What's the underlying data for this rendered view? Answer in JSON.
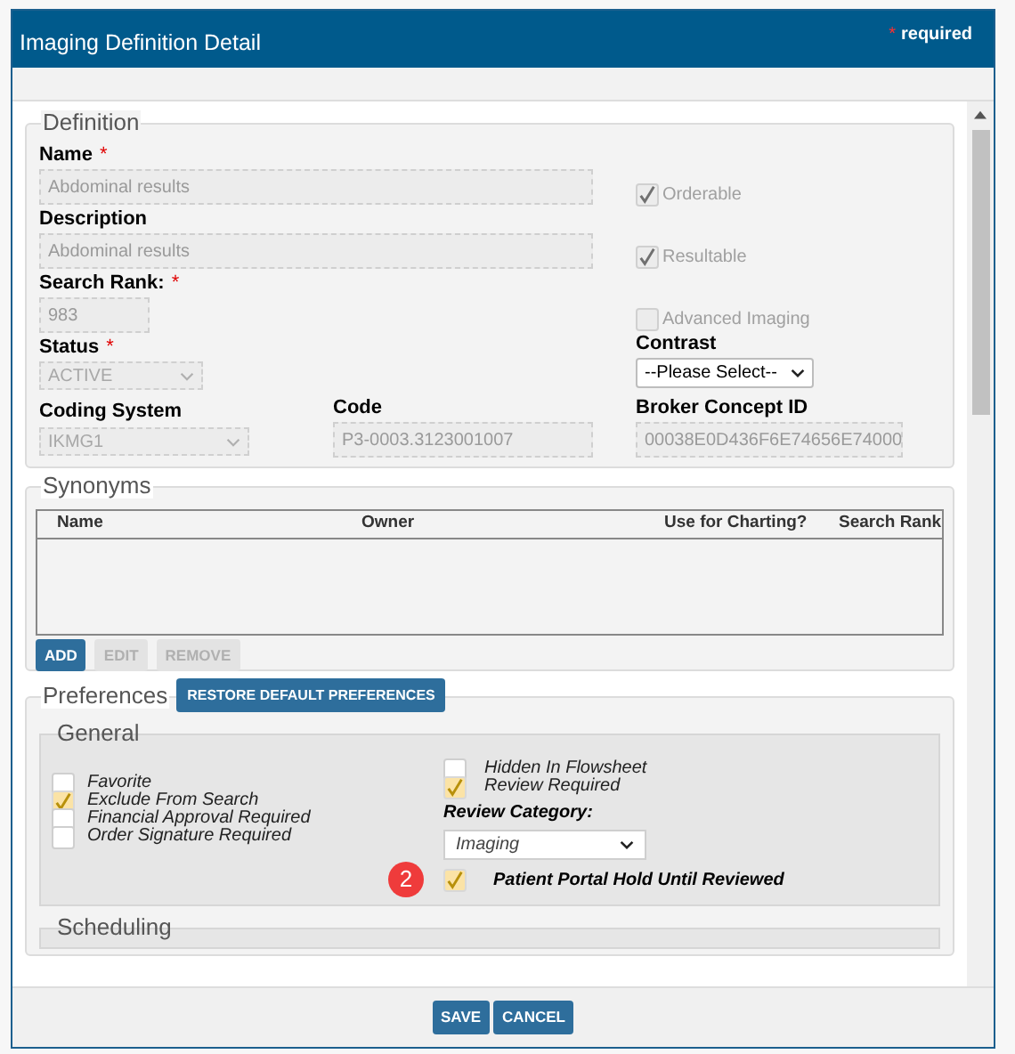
{
  "dialog": {
    "title": "Imaging Definition Detail",
    "required_mark": "*",
    "required_label": "required"
  },
  "definition": {
    "legend": "Definition",
    "name": {
      "label": "Name",
      "marker": "*",
      "value": "Abdominal results"
    },
    "description": {
      "label": "Description",
      "value": "Abdominal results"
    },
    "search_rank": {
      "label": "Search Rank:",
      "marker": "*",
      "value": "983"
    },
    "status": {
      "label": "Status",
      "marker": "*",
      "value": "ACTIVE"
    },
    "flags": [
      {
        "label": "Orderable",
        "checked": true
      },
      {
        "label": "Resultable",
        "checked": true
      },
      {
        "label": "Advanced Imaging",
        "checked": false
      }
    ],
    "contrast": {
      "label": "Contrast",
      "value": "--Please Select--"
    },
    "coding_system": {
      "label": "Coding System",
      "value": "IKMG1"
    },
    "code": {
      "label": "Code",
      "value": "P3-0003.3123001007"
    },
    "broker_concept_id": {
      "label": "Broker Concept ID",
      "value": "00038E0D436F6E74656E74000"
    }
  },
  "synonyms": {
    "legend": "Synonyms",
    "columns": [
      "Name",
      "Owner",
      "Use for Charting?",
      "Search Rank"
    ],
    "buttons": [
      {
        "label": "ADD",
        "disabled": false
      },
      {
        "label": "EDIT",
        "disabled": true
      },
      {
        "label": "REMOVE",
        "disabled": true
      }
    ]
  },
  "preferences": {
    "legend": "Preferences",
    "restore_button": "RESTORE DEFAULT PREFERENCES",
    "general": {
      "legend": "General",
      "left_options": [
        {
          "label": "Favorite",
          "checked": false
        },
        {
          "label": "Exclude From Search",
          "checked": true
        },
        {
          "label": "Financial Approval Required",
          "checked": false
        },
        {
          "label": "Order Signature Required",
          "checked": false
        }
      ],
      "right_options": [
        {
          "label": "Hidden In Flowsheet",
          "checked": false
        },
        {
          "label": "Review Required",
          "checked": true
        }
      ],
      "review_category": {
        "label": "Review Category:",
        "value": "Imaging"
      },
      "step_badge": "2",
      "portal_hold": {
        "label": "Patient Portal Hold Until Reviewed",
        "checked": true
      }
    },
    "scheduling": {
      "legend": "Scheduling"
    }
  },
  "footer": {
    "buttons": [
      "SAVE",
      "CANCEL"
    ]
  }
}
